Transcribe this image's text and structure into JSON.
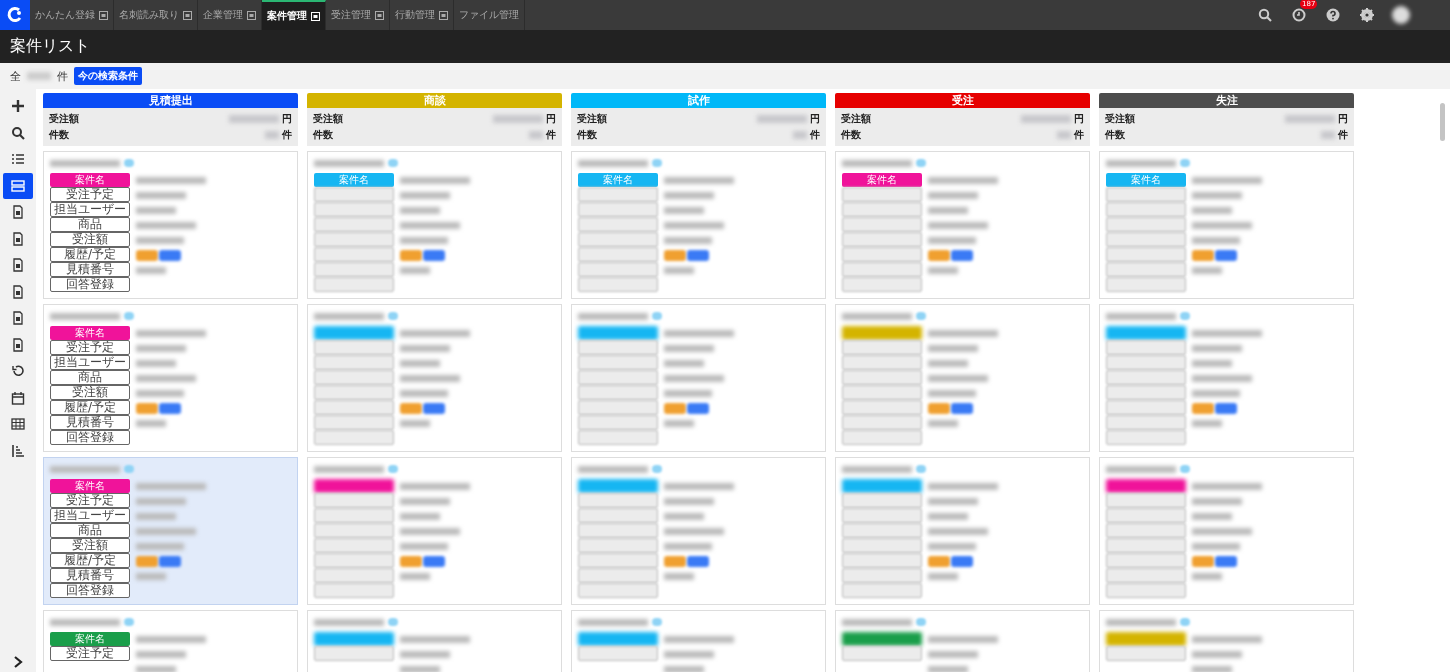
{
  "nav_tabs": [
    {
      "label": "かんたん登録",
      "selected": false,
      "has_icon": true
    },
    {
      "label": "名刺読み取り",
      "selected": false,
      "has_icon": true
    },
    {
      "label": "企業管理",
      "selected": false,
      "has_icon": true
    },
    {
      "label": "案件管理",
      "selected": true,
      "has_icon": true
    },
    {
      "label": "受注管理",
      "selected": false,
      "has_icon": true
    },
    {
      "label": "行動管理",
      "selected": false,
      "has_icon": true
    },
    {
      "label": "ファイル管理",
      "selected": false,
      "has_icon": false
    }
  ],
  "notification_badge": "187",
  "page_title": "案件リスト",
  "filter": {
    "prefix": "全",
    "suffix": "件",
    "button": "今の検索条件"
  },
  "sidebar": [
    {
      "kind": "plus",
      "selected": false
    },
    {
      "kind": "search",
      "selected": false
    },
    {
      "kind": "list",
      "selected": false
    },
    {
      "kind": "cards",
      "selected": true
    },
    {
      "kind": "doc",
      "selected": false
    },
    {
      "kind": "doc",
      "selected": false
    },
    {
      "kind": "doc",
      "selected": false
    },
    {
      "kind": "doc",
      "selected": false
    },
    {
      "kind": "doc",
      "selected": false
    },
    {
      "kind": "doc",
      "selected": false
    },
    {
      "kind": "history",
      "selected": false
    },
    {
      "kind": "calendar",
      "selected": false
    },
    {
      "kind": "table",
      "selected": false
    },
    {
      "kind": "sort",
      "selected": false
    }
  ],
  "columns": [
    {
      "title": "見積提出",
      "color": "#0a4cf5",
      "amount_label": "受注額",
      "amount_unit": "円",
      "count_label": "件数",
      "count_unit": "件",
      "cards": [
        {
          "tag": {
            "label": "案件名",
            "color": "#f0139a"
          },
          "field_labels": [
            "受注予定",
            "担当ユーザー",
            "商品",
            "受注額",
            "履歴/予定",
            "見積番号",
            "回答登録"
          ],
          "highlighted": false
        },
        {
          "tag": {
            "label": "案件名",
            "color": "#f0139a"
          },
          "field_labels": [
            "受注予定",
            "担当ユーザー",
            "商品",
            "受注額",
            "履歴/予定",
            "見積番号",
            "回答登録"
          ],
          "highlighted": false
        },
        {
          "tag": {
            "label": "案件名",
            "color": "#f0139a"
          },
          "field_labels": [
            "受注予定",
            "担当ユーザー",
            "商品",
            "受注額",
            "履歴/予定",
            "見積番号",
            "回答登録"
          ],
          "highlighted": true
        },
        {
          "tag": {
            "label": "案件名",
            "color": "#1a9e4a"
          },
          "field_labels": [
            "受注予定"
          ],
          "highlighted": false
        }
      ]
    },
    {
      "title": "商談",
      "color": "#d4b400",
      "amount_label": "受注額",
      "amount_unit": "円",
      "count_label": "件数",
      "count_unit": "件",
      "cards": [
        {
          "tag": {
            "label": "案件名",
            "color": "#16b6f2"
          },
          "highlighted": false
        },
        {
          "tag": {
            "color": "#16b6f2"
          },
          "highlighted": false
        },
        {
          "tag": {
            "color": "#f0139a"
          },
          "highlighted": false
        },
        {
          "tag": {
            "color": "#16b6f2"
          },
          "highlighted": false
        }
      ]
    },
    {
      "title": "試作",
      "color": "#00b8f8",
      "amount_label": "受注額",
      "amount_unit": "円",
      "count_label": "件数",
      "count_unit": "件",
      "cards": [
        {
          "tag": {
            "label": "案件名",
            "color": "#16b6f2"
          },
          "highlighted": false
        },
        {
          "tag": {
            "color": "#16b6f2"
          },
          "highlighted": false
        },
        {
          "tag": {
            "color": "#16b6f2"
          },
          "highlighted": false
        },
        {
          "tag": {
            "color": "#16b6f2"
          },
          "highlighted": false
        }
      ]
    },
    {
      "title": "受注",
      "color": "#e60000",
      "amount_label": "受注額",
      "amount_unit": "円",
      "count_label": "件数",
      "count_unit": "件",
      "cards": [
        {
          "tag": {
            "label": "案件名",
            "color": "#f0139a"
          },
          "highlighted": false
        },
        {
          "tag": {
            "color": "#d4b400"
          },
          "highlighted": false
        },
        {
          "tag": {
            "color": "#16b6f2"
          },
          "highlighted": false
        },
        {
          "tag": {
            "color": "#1a9e4a"
          },
          "highlighted": false
        }
      ]
    },
    {
      "title": "失注",
      "color": "#4d4d4d",
      "amount_label": "受注額",
      "amount_unit": "円",
      "count_label": "件数",
      "count_unit": "件",
      "cards": [
        {
          "tag": {
            "label": "案件名",
            "color": "#16b6f2"
          },
          "highlighted": false
        },
        {
          "tag": {
            "color": "#16b6f2"
          },
          "highlighted": false
        },
        {
          "tag": {
            "color": "#f0139a"
          },
          "highlighted": false
        },
        {
          "tag": {
            "color": "#d4b400"
          },
          "highlighted": false
        }
      ]
    }
  ]
}
